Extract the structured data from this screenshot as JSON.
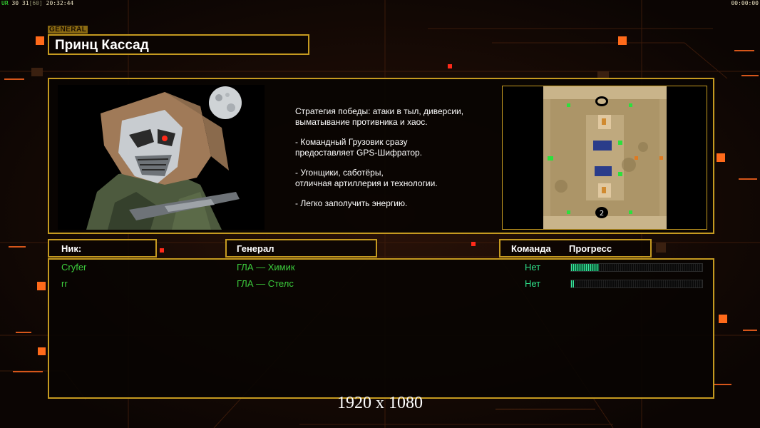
{
  "hud": {
    "fps_prefix": "UR",
    "fps_a": "30",
    "fps_b": "31",
    "fps_c": "[60]",
    "clock": "20:32:44",
    "timer": "00:00:00"
  },
  "general_section_label": "GENERAL",
  "general_name": "Принц Кассад",
  "description": {
    "line1": "Стратегия победы: атаки в тыл, диверсии,\n выматывание противника и хаос.",
    "line2": "- Командный Грузовик сразу\nпредоставляет GPS-Шифратор.",
    "line3": "- Угонщики, саботёры,\nотличная артиллерия и технологии.",
    "line4": "- Легко заполучить энергию."
  },
  "minimap": {
    "start_marker_label": "2"
  },
  "columns": {
    "nick": "Ник:",
    "general": "Генерал",
    "team": "Команда",
    "progress": "Прогресс"
  },
  "players": [
    {
      "nick": "Cryfer",
      "general": "ГЛА — Химик",
      "team": "Нет",
      "progress": 0.21
    },
    {
      "nick": "rr",
      "general": "ГЛА — Стелс",
      "team": "Нет",
      "progress": 0.02
    }
  ],
  "resolution_overlay": "1920 x 1080",
  "colors": {
    "frame_gold": "#c59a20",
    "player_green": "#3ccc3c",
    "team_teal": "#2fe08a",
    "progress_fill": "#3ce8a0",
    "accent_orange": "#ff6a1a"
  }
}
